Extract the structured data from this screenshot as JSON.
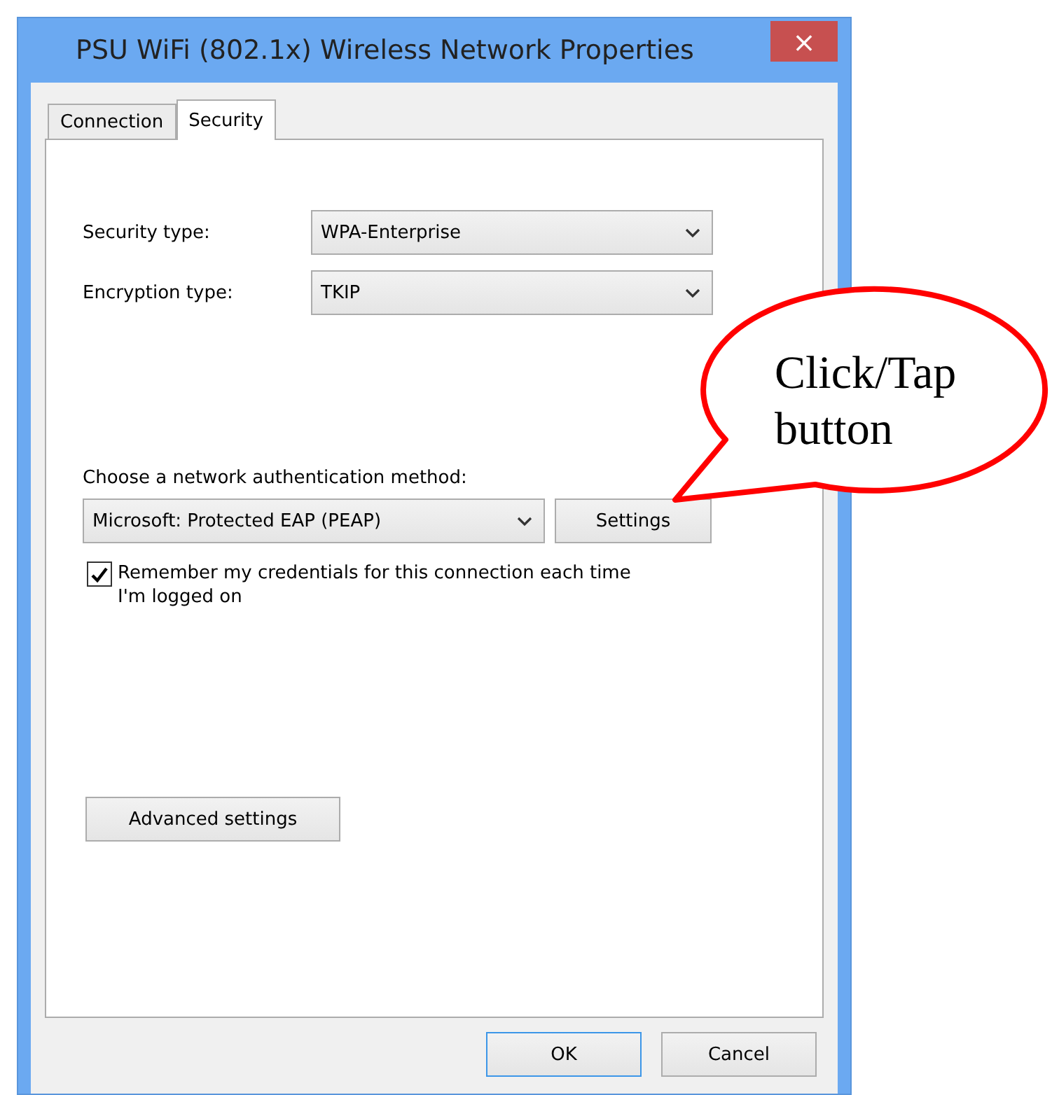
{
  "window": {
    "title": "PSU WiFi (802.1x) Wireless Network Properties",
    "close": "×"
  },
  "tabs": [
    {
      "label": "Connection",
      "selected": false
    },
    {
      "label": "Security",
      "selected": true
    }
  ],
  "fields": [
    {
      "label": "Security type:",
      "value": "WPA-Enterprise"
    },
    {
      "label": "Encryption type:",
      "value": "TKIP"
    }
  ],
  "authentication": {
    "label": "Choose a network authentication method:",
    "method": "Microsoft: Protected EAP (PEAP)",
    "button": "Settings"
  },
  "remember": {
    "label": "Remember my credentials for this connection each time I'm logged on",
    "checked": true
  },
  "advanced_button": "Advanced settings",
  "buttons": [
    {
      "label": "OK",
      "default": true
    },
    {
      "label": "Cancel",
      "default": false
    }
  ],
  "callout": {
    "text": "Click/Tap button"
  }
}
